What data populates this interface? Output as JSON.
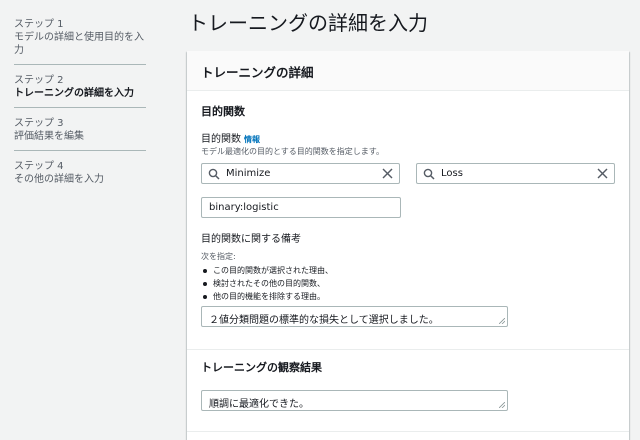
{
  "sidebar": {
    "steps": [
      {
        "num": "ステップ 1",
        "name": "モデルの詳細と使用目的を入力"
      },
      {
        "num": "ステップ 2",
        "name": "トレーニングの詳細を入力"
      },
      {
        "num": "ステップ 3",
        "name": "評価結果を編集"
      },
      {
        "num": "ステップ 4",
        "name": "その他の詳細を入力"
      }
    ]
  },
  "page": {
    "title": "トレーニングの詳細を入力"
  },
  "panel": {
    "header": "トレーニングの詳細",
    "objective_section_title": "目的関数",
    "objective_label": "目的関数",
    "info_link": "情報",
    "objective_desc": "モデル最適化の目的とする目的関数を指定します。",
    "select_direction": "Minimize",
    "select_metric": "Loss",
    "function_value": "binary:logistic",
    "notes_label": "目的関数に関する備考",
    "notes_desc": "次を指定:",
    "notes_bullets": [
      "この目的関数が選択された理由、",
      "検討されたその他の目的関数、",
      "他の目的機能を排除する理由。"
    ],
    "notes_value": "２値分類問題の標準的な損失として選択しました。",
    "observations_title": "トレーニングの観察結果",
    "observations_value": "順調に最適化できた。"
  }
}
